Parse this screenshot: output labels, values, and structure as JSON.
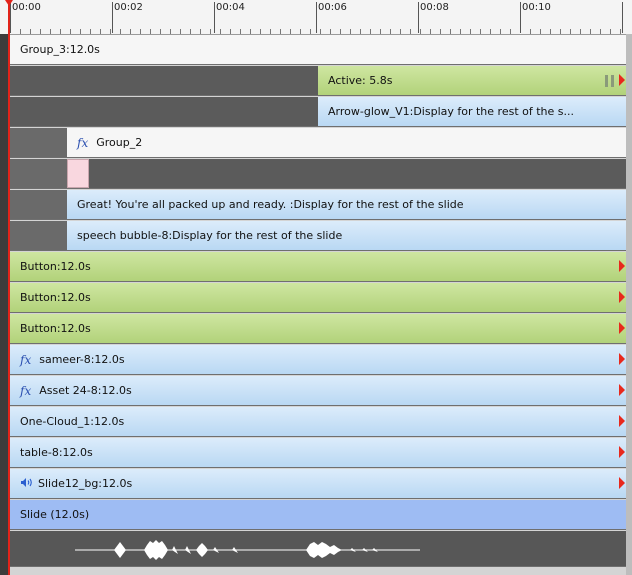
{
  "ruler": {
    "labels": [
      "00:00",
      "00:02",
      "00:04",
      "00:06",
      "00:08",
      "00:10"
    ]
  },
  "tracks": {
    "group3": "Group_3:12.0s",
    "active": "Active: 5.8s",
    "arrow_glow": "Arrow-glow_V1:Display for the rest of the s...",
    "group2": "Group_2",
    "great": "Great! You're all packed up and ready. :Display for the rest of the slide",
    "speech_bubble": "speech bubble-8:Display for the rest of the slide",
    "button1": "Button:12.0s",
    "button2": "Button:12.0s",
    "button3": "Button:12.0s",
    "sameer": "sameer-8:12.0s",
    "asset24": "Asset 24-8:12.0s",
    "one_cloud": "One-Cloud_1:12.0s",
    "table8": "table-8:12.0s",
    "slide12_bg": "Slide12_bg:12.0s",
    "slide": "Slide (12.0s)"
  },
  "icons": {
    "fx_label": "fx",
    "speaker": "speaker-icon",
    "pause": "pause-icon",
    "end_marker": "end-arrow-icon"
  },
  "colors": {
    "playhead": "#e2231a",
    "green_bar": "#b8d684",
    "blue_bar": "#c6e1f7",
    "slide_bar": "#9ebcf3"
  }
}
